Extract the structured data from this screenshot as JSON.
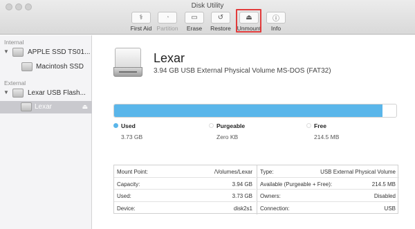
{
  "window": {
    "title": "Disk Utility"
  },
  "toolbar": {
    "first_aid": {
      "label": "First Aid",
      "icon": "stethoscope-icon",
      "glyph": "⚕"
    },
    "partition": {
      "label": "Partition",
      "icon": "partition-icon",
      "glyph": "◔"
    },
    "erase": {
      "label": "Erase",
      "icon": "erase-icon",
      "glyph": "▭"
    },
    "restore": {
      "label": "Restore",
      "icon": "restore-icon",
      "glyph": "↺"
    },
    "unmount": {
      "label": "Unmount",
      "icon": "unmount-icon",
      "glyph": "⏏"
    },
    "info": {
      "label": "Info",
      "icon": "info-icon",
      "glyph": "ⓘ"
    },
    "highlight_color": "#e23b3b"
  },
  "sidebar": {
    "internal_header": "Internal",
    "external_header": "External",
    "items": [
      {
        "label": "APPLE SSD TS01..."
      },
      {
        "label": "Macintosh SSD"
      },
      {
        "label": "Lexar USB Flash..."
      },
      {
        "label": "Lexar",
        "selected": true
      }
    ]
  },
  "volume": {
    "name": "Lexar",
    "description": "3.94 GB USB External Physical Volume MS-DOS (FAT32)"
  },
  "usage": {
    "used_fraction": 0.951,
    "used_color": "#5ab6ea",
    "legend": [
      {
        "name": "Used",
        "value": "3.73 GB",
        "color": "#5ab6ea"
      },
      {
        "name": "Purgeable",
        "value": "Zero KB",
        "color": "#ffffff"
      },
      {
        "name": "Free",
        "value": "214.5 MB",
        "color": "#ffffff"
      }
    ]
  },
  "info": {
    "left": [
      {
        "key": "Mount Point:",
        "value": "/Volumes/Lexar"
      },
      {
        "key": "Capacity:",
        "value": "3.94 GB"
      },
      {
        "key": "Used:",
        "value": "3.73 GB"
      },
      {
        "key": "Device:",
        "value": "disk2s1"
      }
    ],
    "right": [
      {
        "key": "Type:",
        "value": "USB External Physical Volume"
      },
      {
        "key": "Available (Purgeable + Free):",
        "value": "214.5 MB"
      },
      {
        "key": "Owners:",
        "value": "Disabled"
      },
      {
        "key": "Connection:",
        "value": "USB"
      }
    ]
  }
}
